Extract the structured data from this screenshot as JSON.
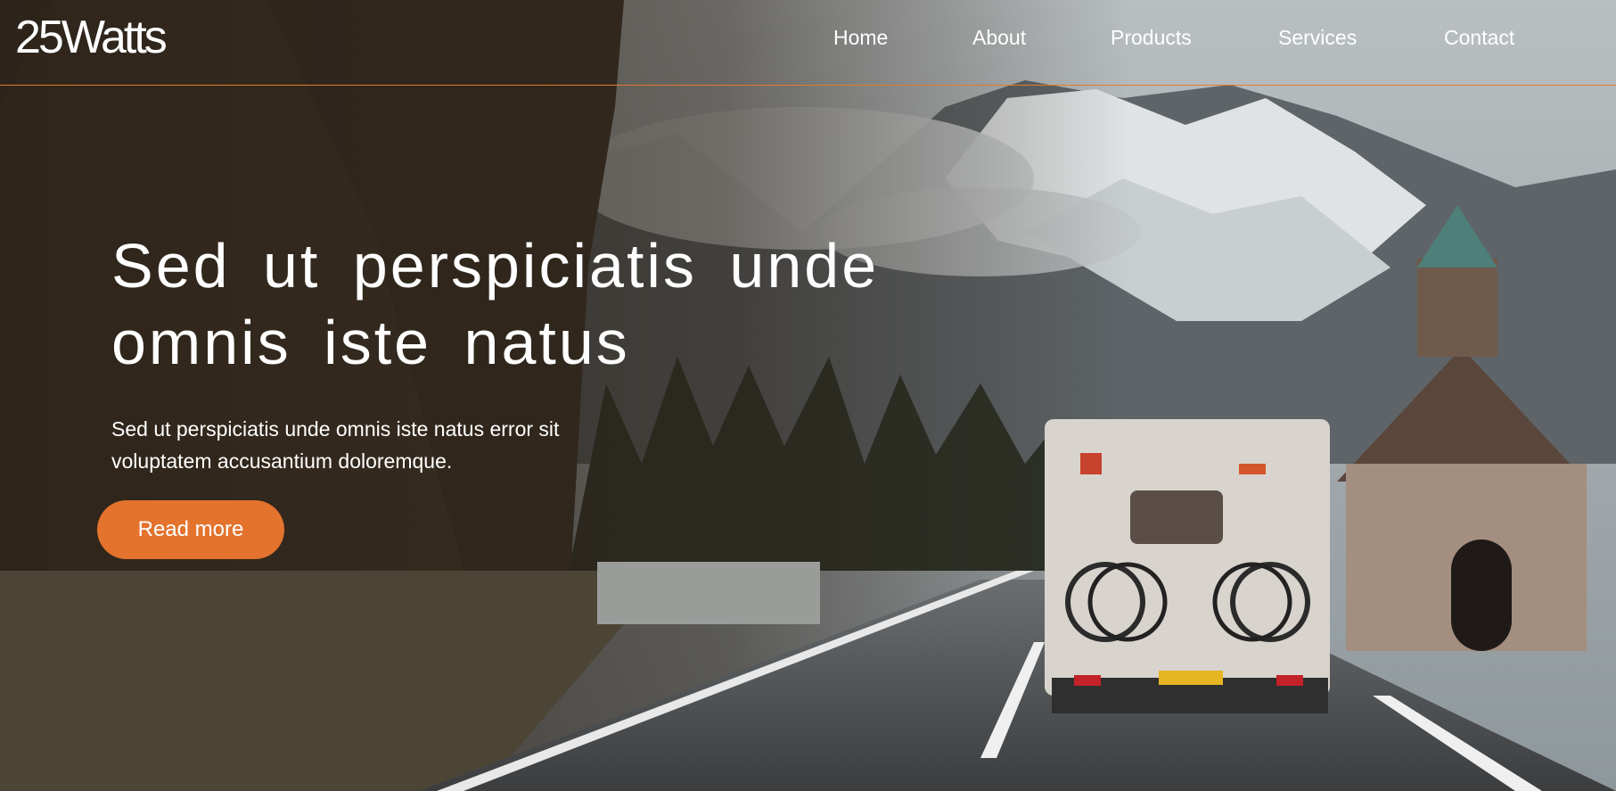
{
  "brand": {
    "logo_text": "25Watts",
    "accent": "#e3732d"
  },
  "nav": {
    "items": [
      {
        "label": "Home"
      },
      {
        "label": "About"
      },
      {
        "label": "Products"
      },
      {
        "label": "Services"
      },
      {
        "label": "Contact"
      }
    ]
  },
  "hero": {
    "title": "Sed ut perspiciatis unde omnis iste natus",
    "subtitle": "Sed ut perspiciatis unde omnis iste natus error sit voluptatem accusantium doloremque.",
    "cta_label": "Read more"
  }
}
